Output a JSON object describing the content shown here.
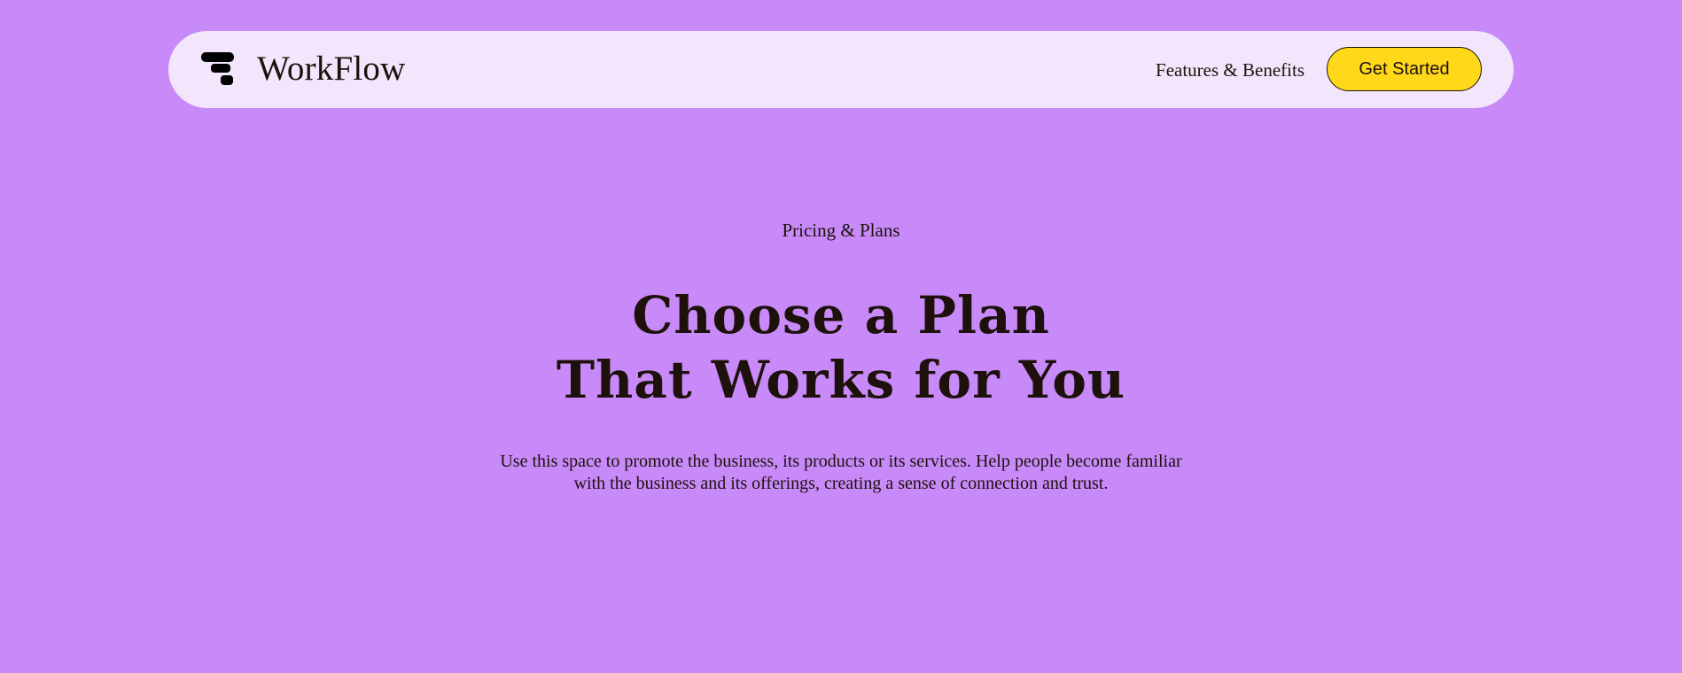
{
  "header": {
    "brand": "WorkFlow",
    "logo_icon": "workflow-logo-mark",
    "nav_link": "Features & Benefits",
    "cta_label": "Get Started"
  },
  "hero": {
    "eyebrow": "Pricing & Plans",
    "headline_line1": "Choose a Plan",
    "headline_line2": "That Works for You",
    "description": "Use this space to promote the business, its products or its services. Help people become familiar with the business and its offerings, creating a sense of connection and trust."
  },
  "colors": {
    "background": "#c78af8",
    "header_background": "#f3e5fc",
    "cta_background": "#ffd81a",
    "text": "#1e110c"
  }
}
